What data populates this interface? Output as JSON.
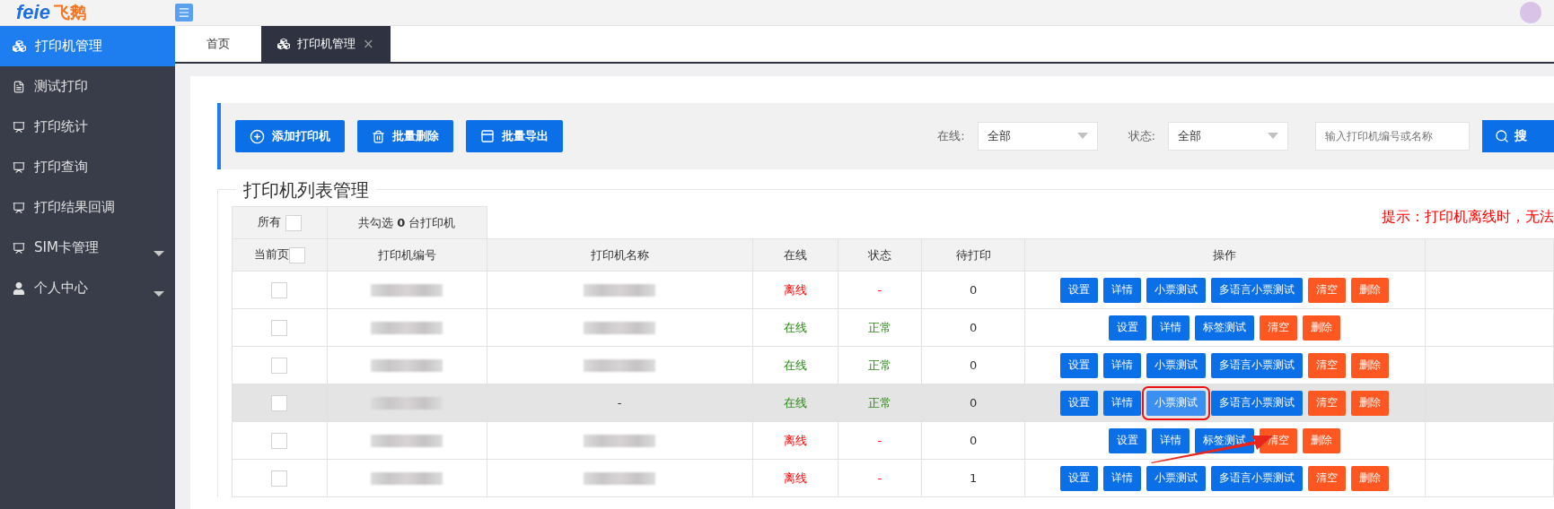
{
  "logo": {
    "latin": "feie",
    "chinese": "飞鹅"
  },
  "sidebar": {
    "items": [
      {
        "label": "打印机管理",
        "selected": true,
        "expandable": false
      },
      {
        "label": "测试打印",
        "selected": false,
        "expandable": false
      },
      {
        "label": "打印统计",
        "selected": false,
        "expandable": false
      },
      {
        "label": "打印查询",
        "selected": false,
        "expandable": false
      },
      {
        "label": "打印结果回调",
        "selected": false,
        "expandable": false
      },
      {
        "label": "SIM卡管理",
        "selected": false,
        "expandable": true
      },
      {
        "label": "个人中心",
        "selected": false,
        "expandable": true
      }
    ]
  },
  "tabs": [
    {
      "label": "首页",
      "selected": false
    },
    {
      "label": "打印机管理",
      "selected": true,
      "close": "×"
    }
  ],
  "toolbar": {
    "buttons": [
      {
        "label": "添加打印机"
      },
      {
        "label": "批量删除"
      },
      {
        "label": "批量导出"
      }
    ],
    "filters": [
      {
        "label": "在线:",
        "value": "全部"
      },
      {
        "label": "状态:",
        "value": "全部"
      }
    ],
    "search": {
      "placeholder": "输入打印机编号或名称",
      "button": "搜"
    }
  },
  "section_title": "打印机列表管理",
  "tip": "提示：打印机离线时，无法",
  "table": {
    "select_all": {
      "label": "所有",
      "checked": false
    },
    "selected_count": {
      "prefix": "共勾选 ",
      "count": "0",
      "suffix": " 台打印机"
    },
    "select_page": {
      "label": "当前页",
      "checked": false
    },
    "columns": [
      "打印机编号",
      "打印机名称",
      "在线",
      "状态",
      "待打印",
      "操作"
    ],
    "rows": [
      {
        "checked": false,
        "hovered": false,
        "id": {
          "kind": "redacted"
        },
        "name": {
          "kind": "redacted"
        },
        "online": {
          "text": "离线",
          "on": false
        },
        "status": {
          "text": "-",
          "on": false
        },
        "pending": "0",
        "actions": [
          {
            "label": "设置",
            "kind": "primary",
            "highlighted": false
          },
          {
            "label": "详情",
            "kind": "primary",
            "highlighted": false
          },
          {
            "label": "小票测试",
            "kind": "primary",
            "highlighted": false
          },
          {
            "label": "多语言小票测试",
            "kind": "primary",
            "highlighted": false
          },
          {
            "label": "清空",
            "kind": "warn",
            "highlighted": false
          },
          {
            "label": "删除",
            "kind": "warn",
            "highlighted": false
          }
        ]
      },
      {
        "checked": false,
        "hovered": false,
        "id": {
          "kind": "redacted"
        },
        "name": {
          "kind": "redacted"
        },
        "online": {
          "text": "在线",
          "on": true
        },
        "status": {
          "text": "正常",
          "on": true
        },
        "pending": "0",
        "actions": [
          {
            "label": "设置",
            "kind": "primary",
            "highlighted": false
          },
          {
            "label": "详情",
            "kind": "primary",
            "highlighted": false
          },
          {
            "label": "标签测试",
            "kind": "primary",
            "highlighted": false
          },
          {
            "label": "清空",
            "kind": "warn",
            "highlighted": false
          },
          {
            "label": "删除",
            "kind": "warn",
            "highlighted": false
          }
        ]
      },
      {
        "checked": false,
        "hovered": false,
        "id": {
          "kind": "redacted"
        },
        "name": {
          "kind": "redacted"
        },
        "online": {
          "text": "在线",
          "on": true
        },
        "status": {
          "text": "正常",
          "on": true
        },
        "pending": "0",
        "actions": [
          {
            "label": "设置",
            "kind": "primary",
            "highlighted": false
          },
          {
            "label": "详情",
            "kind": "primary",
            "highlighted": false
          },
          {
            "label": "小票测试",
            "kind": "primary",
            "highlighted": false
          },
          {
            "label": "多语言小票测试",
            "kind": "primary",
            "highlighted": false
          },
          {
            "label": "清空",
            "kind": "warn",
            "highlighted": false
          },
          {
            "label": "删除",
            "kind": "warn",
            "highlighted": false
          }
        ]
      },
      {
        "checked": false,
        "hovered": true,
        "id": {
          "kind": "redacted"
        },
        "name": {
          "kind": "text",
          "text": "-"
        },
        "online": {
          "text": "在线",
          "on": true
        },
        "status": {
          "text": "正常",
          "on": true
        },
        "pending": "0",
        "actions": [
          {
            "label": "设置",
            "kind": "primary",
            "highlighted": false
          },
          {
            "label": "详情",
            "kind": "primary",
            "highlighted": false
          },
          {
            "label": "小票测试",
            "kind": "primary",
            "highlighted": true
          },
          {
            "label": "多语言小票测试",
            "kind": "primary",
            "highlighted": false
          },
          {
            "label": "清空",
            "kind": "warn",
            "highlighted": false
          },
          {
            "label": "删除",
            "kind": "warn",
            "highlighted": false
          }
        ]
      },
      {
        "checked": false,
        "hovered": false,
        "id": {
          "kind": "redacted"
        },
        "name": {
          "kind": "redacted"
        },
        "online": {
          "text": "离线",
          "on": false
        },
        "status": {
          "text": "-",
          "on": false
        },
        "pending": "0",
        "actions": [
          {
            "label": "设置",
            "kind": "primary",
            "highlighted": false
          },
          {
            "label": "详情",
            "kind": "primary",
            "highlighted": false
          },
          {
            "label": "标签测试",
            "kind": "primary",
            "highlighted": false
          },
          {
            "label": "清空",
            "kind": "warn",
            "highlighted": false
          },
          {
            "label": "删除",
            "kind": "warn",
            "highlighted": false
          }
        ]
      },
      {
        "checked": false,
        "hovered": false,
        "id": {
          "kind": "redacted"
        },
        "name": {
          "kind": "redacted"
        },
        "online": {
          "text": "离线",
          "on": false
        },
        "status": {
          "text": "-",
          "on": false
        },
        "pending": "1",
        "actions": [
          {
            "label": "设置",
            "kind": "primary",
            "highlighted": false
          },
          {
            "label": "详情",
            "kind": "primary",
            "highlighted": false
          },
          {
            "label": "小票测试",
            "kind": "primary",
            "highlighted": false
          },
          {
            "label": "多语言小票测试",
            "kind": "primary",
            "highlighted": false
          },
          {
            "label": "清空",
            "kind": "warn",
            "highlighted": false
          },
          {
            "label": "删除",
            "kind": "warn",
            "highlighted": false
          }
        ]
      }
    ]
  },
  "annotation": {
    "arrow": true
  }
}
